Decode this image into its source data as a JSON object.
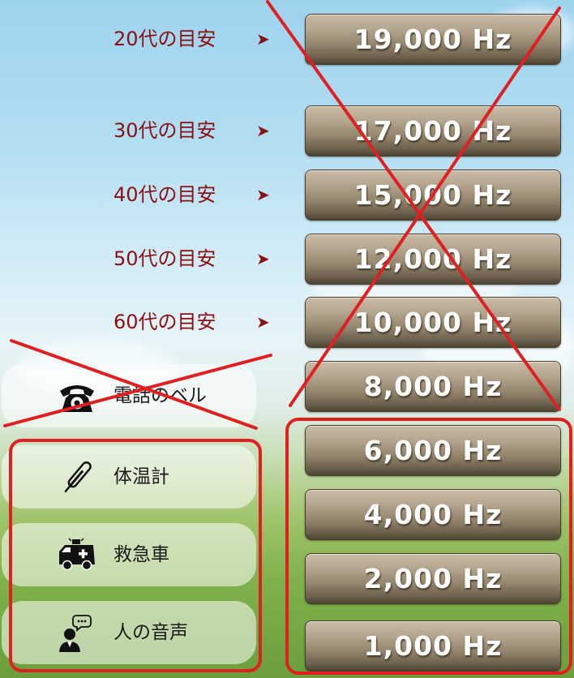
{
  "age_guides": [
    {
      "label": "20代の目安",
      "arrow": "➤"
    },
    {
      "label": "30代の目安",
      "arrow": "➤"
    },
    {
      "label": "40代の目安",
      "arrow": "➤"
    },
    {
      "label": "50代の目安",
      "arrow": "➤"
    },
    {
      "label": "60代の目安",
      "arrow": "➤"
    }
  ],
  "frequency_buttons": [
    {
      "label": "19,000 Hz"
    },
    {
      "label": "17,000 Hz"
    },
    {
      "label": "15,000 Hz"
    },
    {
      "label": "12,000 Hz"
    },
    {
      "label": "10,000 Hz"
    },
    {
      "label": "8,000 Hz"
    },
    {
      "label": "6,000 Hz"
    },
    {
      "label": "4,000 Hz"
    },
    {
      "label": "2,000 Hz"
    },
    {
      "label": "1,000 Hz"
    }
  ],
  "sound_samples": [
    {
      "label": "電話のベル",
      "icon": "telephone-icon"
    },
    {
      "label": "体温計",
      "icon": "thermometer-icon"
    },
    {
      "label": "救急車",
      "icon": "ambulance-icon"
    },
    {
      "label": "人の音声",
      "icon": "person-speaking-icon"
    }
  ],
  "annotation_color": "#e02020",
  "age_label_color": "#8b1010"
}
